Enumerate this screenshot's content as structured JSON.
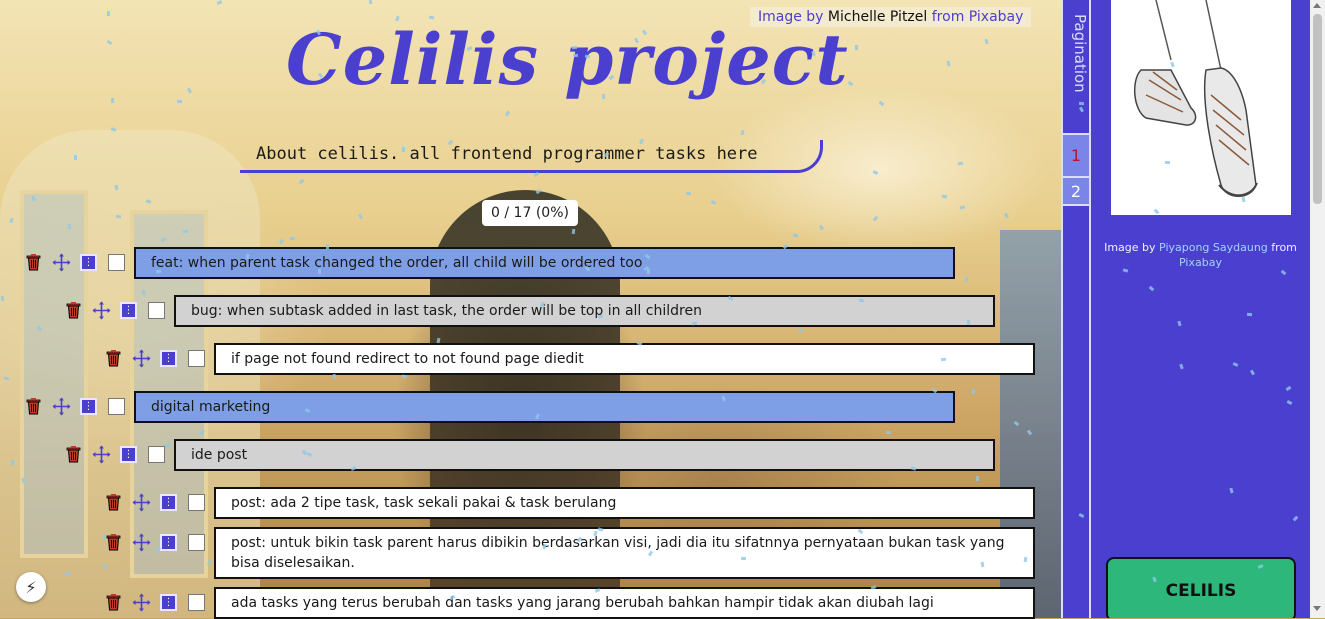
{
  "background_credit": {
    "prefix": "Image by",
    "author": "Michelle Pitzel",
    "source": "from Pixabay"
  },
  "header": {
    "title": "Celilis project",
    "subtitle": "About celilis. all frontend programmer tasks here"
  },
  "progress": {
    "done": 0,
    "total": 17,
    "label": "0 / 17 (0%)"
  },
  "tasks": [
    {
      "level": 0,
      "text": "feat: when parent task changed the order, all child will be ordered too"
    },
    {
      "level": 1,
      "text": "bug: when subtask added in last task, the order will be top in all children"
    },
    {
      "level": 2,
      "text": "if page not found redirect to not found page diedit"
    },
    {
      "level": 0,
      "text": "digital marketing"
    },
    {
      "level": 1,
      "text": "ide post"
    },
    {
      "level": 2,
      "text": "post: ada 2 tipe task, task sekali pakai & task berulang"
    },
    {
      "level": 2,
      "text": "post: untuk bikin task parent harus dibikin berdasarkan visi, jadi dia itu sifatnnya pernyataan bukan task yang bisa diselesaikan."
    },
    {
      "level": 2,
      "text": "ada tasks yang terus berubah dan tasks yang jarang berubah bahkan hampir tidak akan diubah lagi"
    }
  ],
  "pagination": {
    "label": "Pagination",
    "pages": [
      "1",
      "2"
    ],
    "current": "1"
  },
  "sidebar": {
    "image_credit": {
      "prefix": "Image by",
      "author": "Piyapong Saydaung",
      "source": "from",
      "site": "Pixabay"
    },
    "button_label": "CELILIS"
  },
  "colors": {
    "accent": "#4b3fcf",
    "level0": "#7e9fe6",
    "level1": "#d2d2d2",
    "level2": "#ffffff",
    "trash": "#c0392b",
    "button": "#2db77a"
  },
  "icons": {
    "delete": "trash-icon",
    "drag": "move-icon",
    "menu": "kebab-menu-icon",
    "quick": "lightning-icon"
  }
}
